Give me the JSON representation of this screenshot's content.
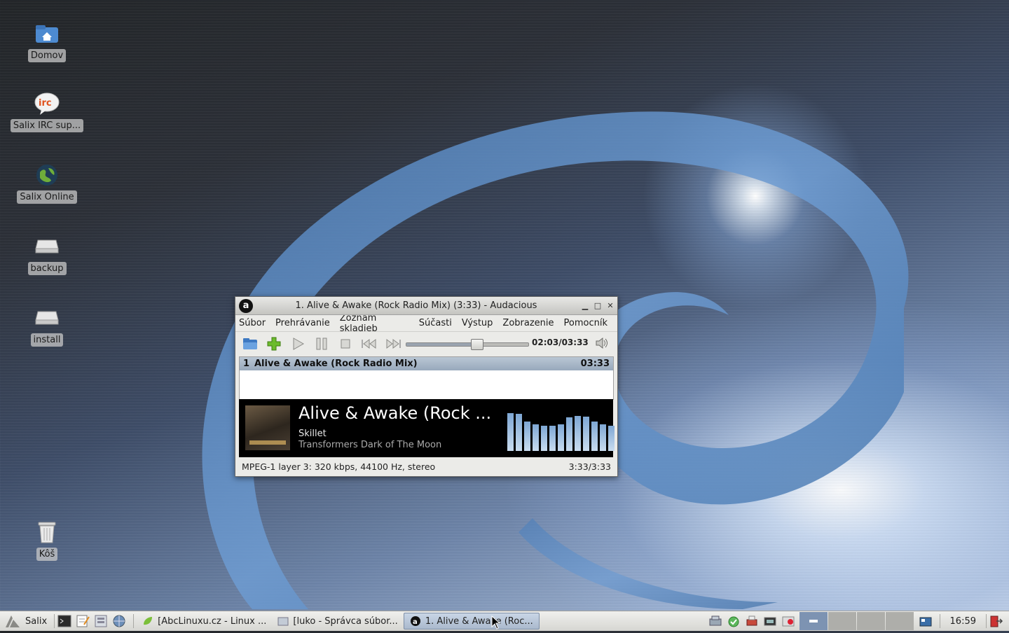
{
  "desktop": {
    "icons": [
      {
        "label": "Domov",
        "icon": "home-folder-icon"
      },
      {
        "label": "Salix IRC sup...",
        "icon": "irc-icon"
      },
      {
        "label": "Salix Online",
        "icon": "globe-icon"
      },
      {
        "label": "backup",
        "icon": "drive-icon"
      },
      {
        "label": "install",
        "icon": "drive-icon"
      },
      {
        "label": "Kôš",
        "icon": "trash-icon"
      }
    ]
  },
  "window": {
    "title": "1. Alive & Awake (Rock Radio Mix) (3:33) - Audacious",
    "app_icon_letter": "a",
    "menu": [
      "Súbor",
      "Prehrávanie",
      "Zoznam skladieb",
      "Súčasti",
      "Výstup",
      "Zobrazenie",
      "Pomocník"
    ],
    "timecode": "02:03/03:33",
    "progress": 0.577,
    "playlist": [
      {
        "num": "1",
        "title": "Alive & Awake (Rock Radio Mix)",
        "length": "03:33"
      }
    ],
    "now_playing": {
      "title": "Alive & Awake (Rock ...",
      "artist": "Skillet",
      "album": "Transformers Dark of The Moon"
    },
    "visualizer_levels": [
      0.82,
      0.8,
      0.63,
      0.57,
      0.55,
      0.55,
      0.58,
      0.72,
      0.76,
      0.74,
      0.63,
      0.58,
      0.55
    ],
    "status_left": "MPEG-1 layer 3: 320 kbps, 44100 Hz, stereo",
    "status_right": "3:33/3:33",
    "accent": "#98a9bc"
  },
  "taskbar": {
    "start_label": "Salix",
    "tasks": [
      {
        "label": "[AbcLinuxu.cz - Linux ...",
        "active": false
      },
      {
        "label": "[luko - Správca súbor...",
        "active": false
      },
      {
        "label": "1. Alive & Awake (Roc...",
        "active": true
      }
    ],
    "clock": "16:59"
  }
}
